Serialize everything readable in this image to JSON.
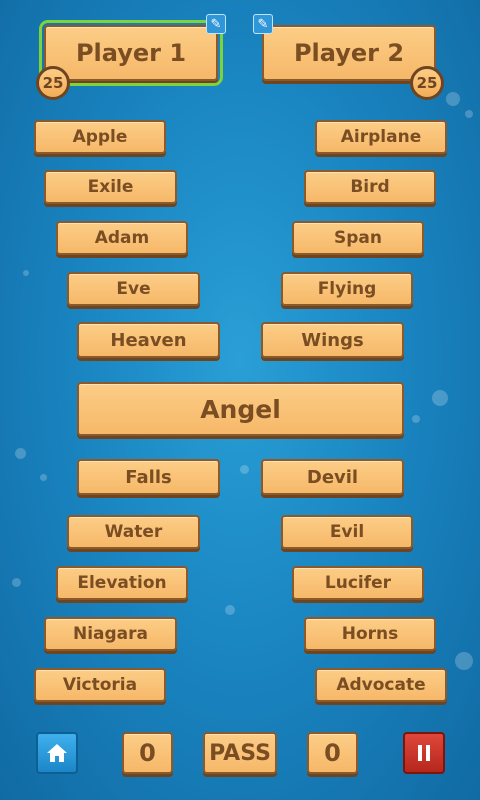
{
  "players": [
    {
      "name": "Player 1",
      "score": "25",
      "edit_icon": "pencil-icon"
    },
    {
      "name": "Player 2",
      "score": "25",
      "edit_icon": "pencil-icon"
    }
  ],
  "left_words": [
    "Apple",
    "Exile",
    "Adam",
    "Eve",
    "Heaven",
    "Falls",
    "Water",
    "Elevation",
    "Niagara",
    "Victoria"
  ],
  "right_words": [
    "Airplane",
    "Bird",
    "Span",
    "Flying",
    "Wings",
    "Devil",
    "Evil",
    "Lucifer",
    "Horns",
    "Advocate"
  ],
  "center_word": "Angel",
  "footer": {
    "home_icon": "home-icon",
    "left_count": "0",
    "pass_label": "PASS",
    "right_count": "0",
    "pause_icon": "pause-icon"
  },
  "colors": {
    "accent": "#7ed23a",
    "tile": "#f6b869",
    "text": "#7a4e22",
    "home": "#1c86c8",
    "pause": "#b5271c"
  }
}
